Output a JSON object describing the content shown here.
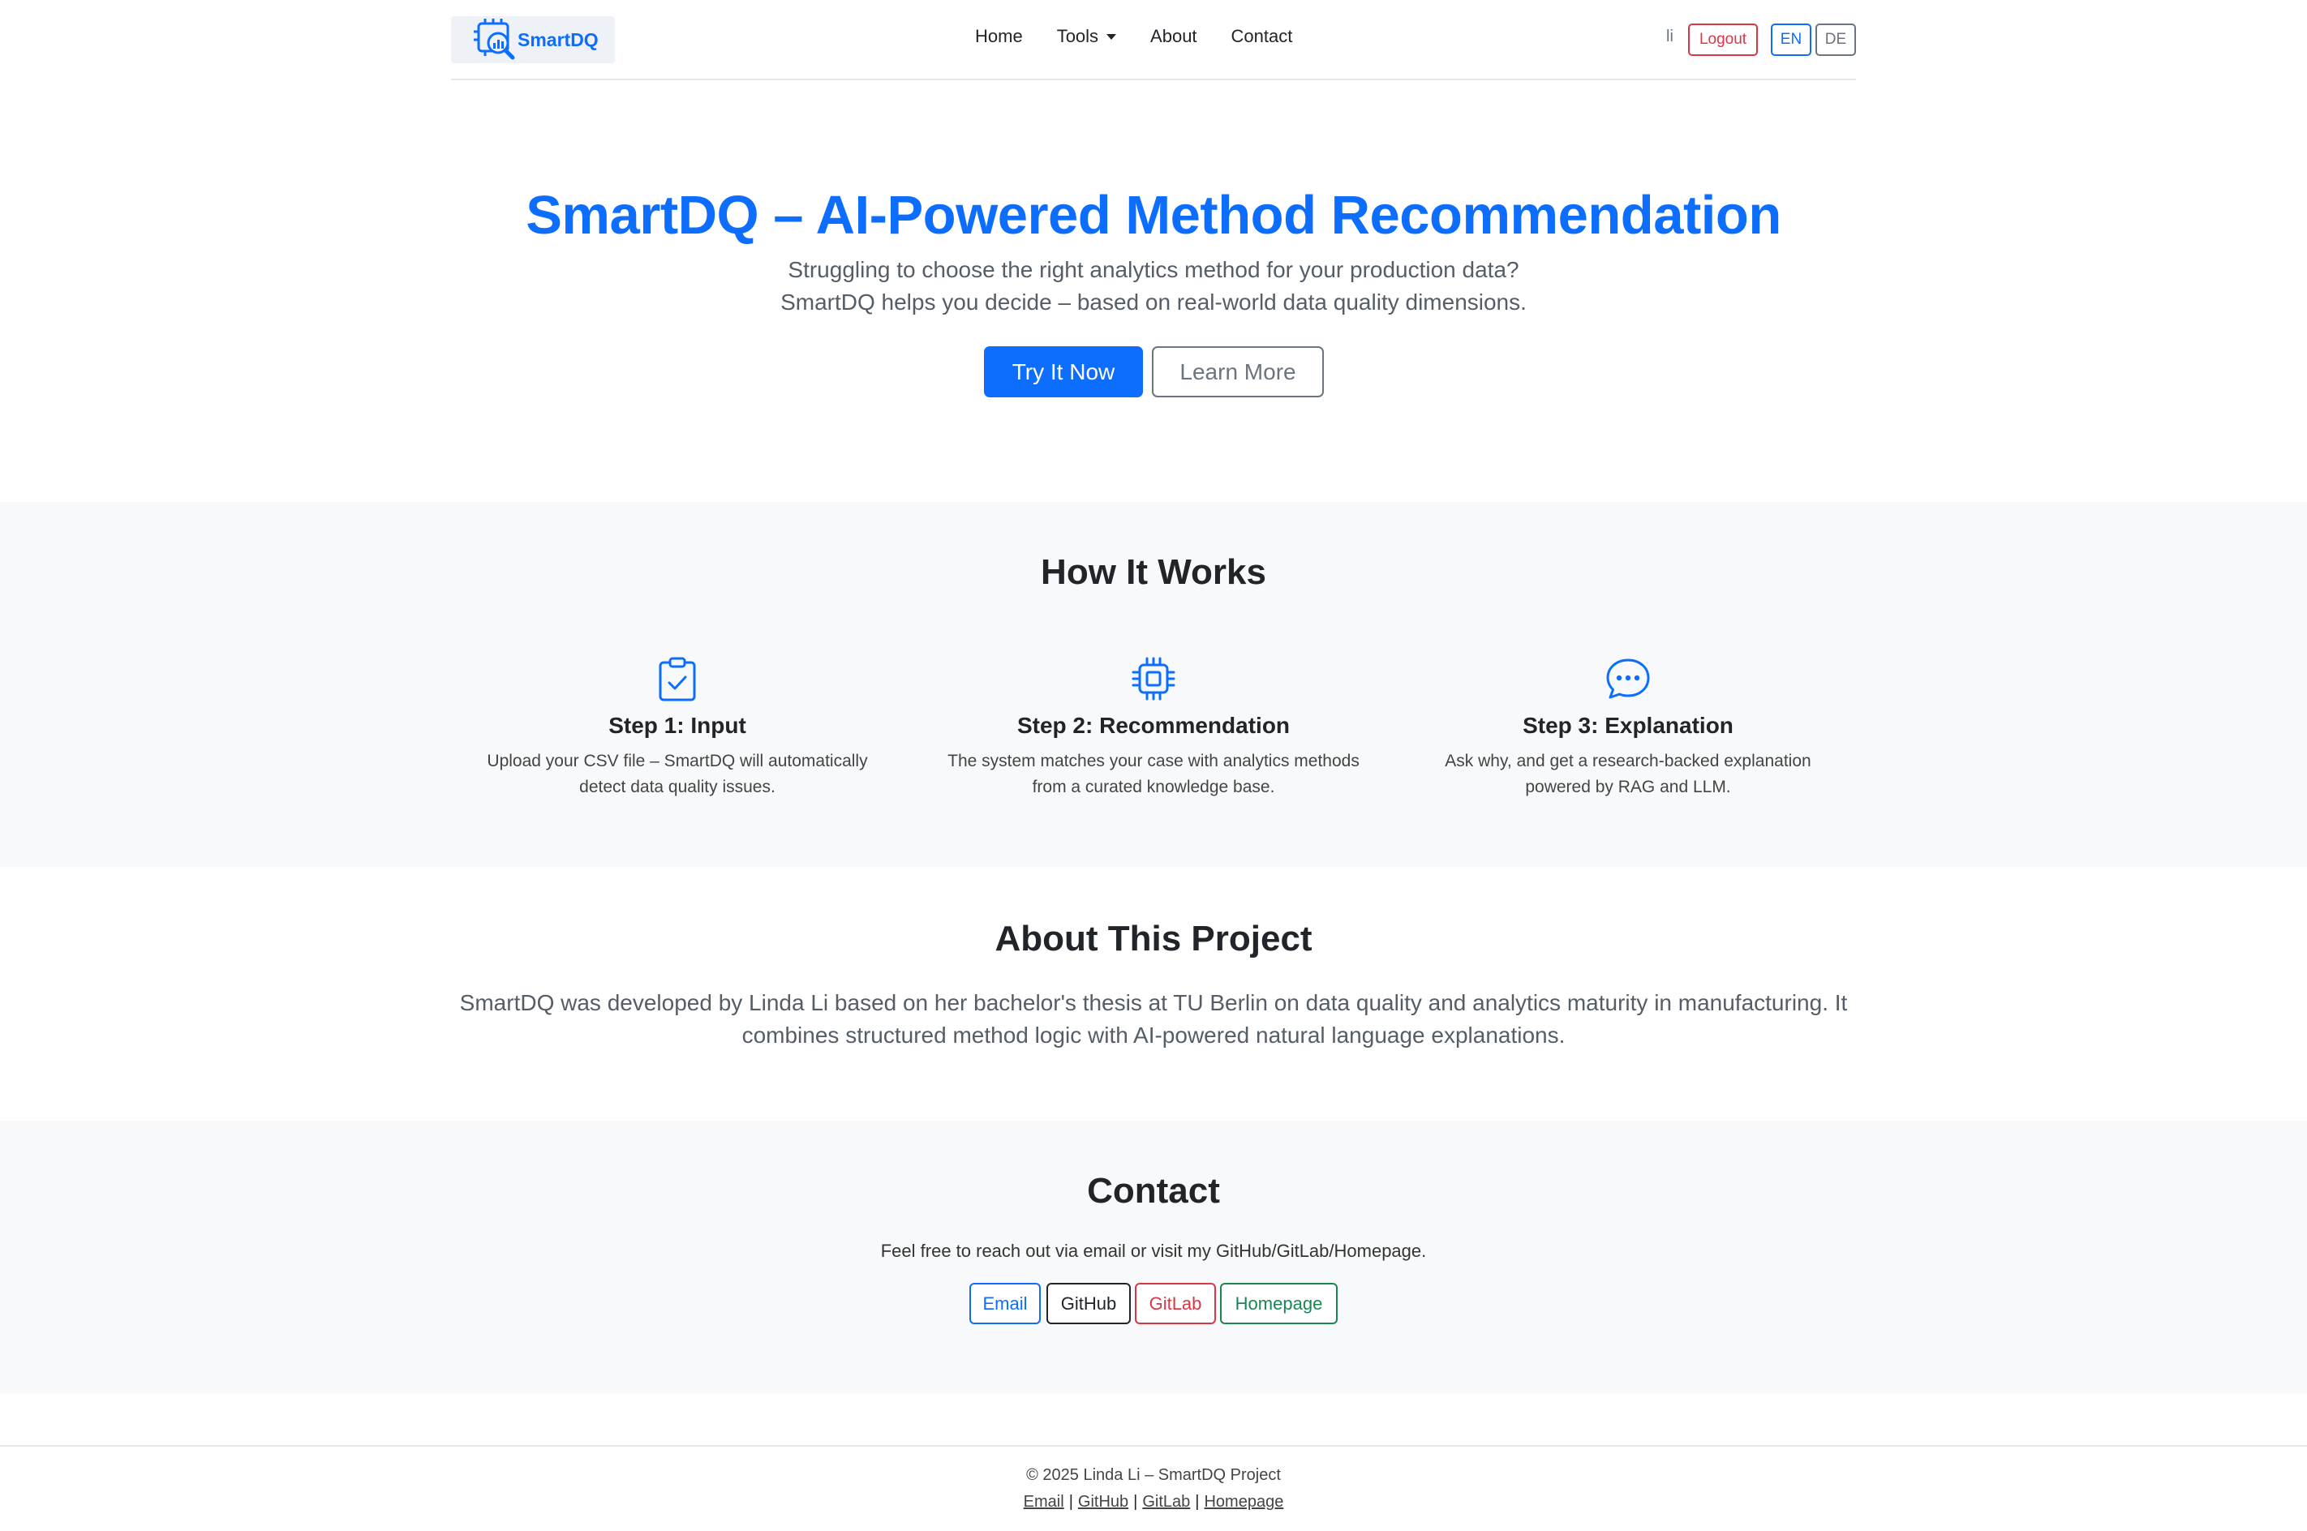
{
  "navbar": {
    "brand": "SmartDQ",
    "links": [
      "Home",
      "Tools",
      "About",
      "Contact"
    ],
    "user": "li",
    "logout": "Logout",
    "lang_en": "EN",
    "lang_de": "DE"
  },
  "hero": {
    "title": "SmartDQ – AI-Powered Method Recommendation",
    "line1": "Struggling to choose the right analytics method for your production data?",
    "line2": "SmartDQ helps you decide – based on real-world data quality dimensions.",
    "try_button": "Try It Now",
    "learn_button": "Learn More"
  },
  "how": {
    "title": "How It Works",
    "steps": [
      {
        "icon": "clipboard-check-icon",
        "title": "Step 1: Input",
        "line1": "Upload your CSV file – SmartDQ will automatically",
        "line2": "detect data quality issues."
      },
      {
        "icon": "cpu-icon",
        "title": "Step 2: Recommendation",
        "line1": "The system matches your case with analytics methods",
        "line2": "from a curated knowledge base."
      },
      {
        "icon": "chat-dots-icon",
        "title": "Step 3: Explanation",
        "line1": "Ask why, and get a research-backed explanation",
        "line2": "powered by RAG and LLM."
      }
    ]
  },
  "about": {
    "title": "About This Project",
    "text": "SmartDQ was developed by Linda Li based on her bachelor's thesis at TU Berlin on data quality and analytics maturity in manufacturing. It combines structured method logic with AI-powered natural language explanations."
  },
  "contact": {
    "title": "Contact",
    "text": "Feel free to reach out via email or visit my GitHub/GitLab/Homepage.",
    "buttons": [
      "Email",
      "GitHub",
      "GitLab",
      "Homepage"
    ]
  },
  "footer": {
    "copyright": "© 2025 Linda Li – SmartDQ Project",
    "links": [
      "Email",
      "GitHub",
      "GitLab",
      "Homepage"
    ],
    "separator": "|"
  },
  "colors": {
    "primary": "#0d6efd",
    "danger": "#dc3545",
    "success": "#198754",
    "section_bg": "#f8f9fa"
  }
}
